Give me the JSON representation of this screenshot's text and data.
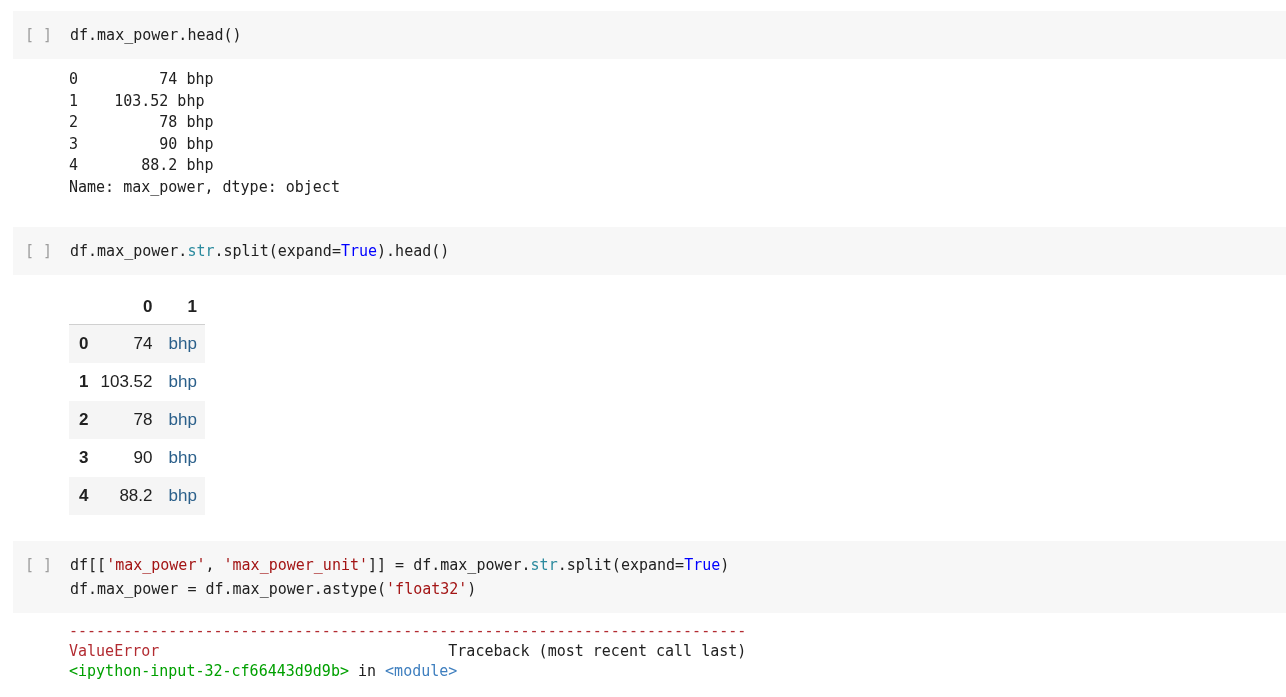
{
  "cells": [
    {
      "prompt": "[ ]",
      "code": [
        [
          {
            "text": "df.max_power.head()",
            "kind": "plain"
          }
        ]
      ],
      "output": {
        "kind": "text",
        "lines": [
          "0         74 bhp",
          "1    103.52 bhp",
          "2         78 bhp",
          "3         90 bhp",
          "4       88.2 bhp",
          "Name: max_power, dtype: object"
        ]
      }
    },
    {
      "prompt": "[ ]",
      "code": [
        [
          {
            "text": "df.max_power.",
            "kind": "plain"
          },
          {
            "text": "str",
            "kind": "builtin"
          },
          {
            "text": ".split(expand=",
            "kind": "plain"
          },
          {
            "text": "True",
            "kind": "keyword"
          },
          {
            "text": ").head()",
            "kind": "plain"
          }
        ]
      ],
      "output": {
        "kind": "table",
        "columns": [
          "",
          "0",
          "1"
        ],
        "rows": [
          [
            "0",
            "74",
            "bhp"
          ],
          [
            "1",
            "103.52",
            "bhp"
          ],
          [
            "2",
            "78",
            "bhp"
          ],
          [
            "3",
            "90",
            "bhp"
          ],
          [
            "4",
            "88.2",
            "bhp"
          ]
        ]
      }
    },
    {
      "prompt": "[ ]",
      "code": [
        [
          {
            "text": "df[[",
            "kind": "plain"
          },
          {
            "text": "'max_power'",
            "kind": "string"
          },
          {
            "text": ", ",
            "kind": "plain"
          },
          {
            "text": "'max_power_unit'",
            "kind": "string"
          },
          {
            "text": "]] = df.max_power.",
            "kind": "plain"
          },
          {
            "text": "str",
            "kind": "builtin"
          },
          {
            "text": ".split(expand=",
            "kind": "plain"
          },
          {
            "text": "True",
            "kind": "keyword"
          },
          {
            "text": ")",
            "kind": "plain"
          }
        ],
        [
          {
            "text": "df.max_power = df.max_power.astype(",
            "kind": "plain"
          },
          {
            "text": "'float32'",
            "kind": "string"
          },
          {
            "text": ")",
            "kind": "plain"
          }
        ]
      ],
      "output": {
        "kind": "error",
        "lines": [
          [
            {
              "text": "---------------------------------------------------------------------------",
              "kind": "error"
            }
          ],
          [
            {
              "text": "ValueError",
              "kind": "error"
            },
            {
              "text": "                                Traceback (most recent call last)",
              "kind": "plain"
            }
          ],
          [
            {
              "text": "<ipython-input-32-cf66443d9d9b>",
              "kind": "file"
            },
            {
              "text": " in ",
              "kind": "plain"
            },
            {
              "text": "<module>",
              "kind": "link"
            }
          ]
        ]
      }
    }
  ]
}
